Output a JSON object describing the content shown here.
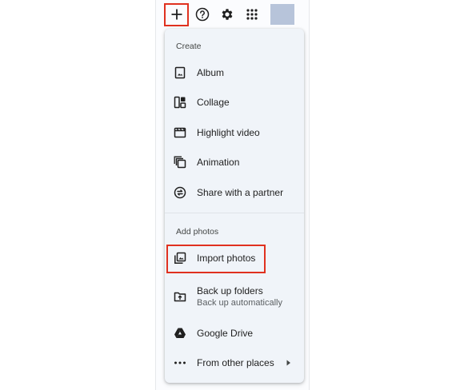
{
  "topbar": {
    "icons": [
      "plus-icon",
      "help-icon",
      "gear-icon",
      "apps-grid-icon"
    ],
    "colors": {
      "highlight": "#e0311f",
      "menu_bg": "#f0f4f9",
      "icon": "#1f1f1f"
    }
  },
  "menu": {
    "create_label": "Create",
    "create_items": [
      {
        "label": "Album",
        "icon": "album-icon"
      },
      {
        "label": "Collage",
        "icon": "collage-icon"
      },
      {
        "label": "Highlight video",
        "icon": "highlight-video-icon"
      },
      {
        "label": "Animation",
        "icon": "animation-icon"
      },
      {
        "label": "Share with a partner",
        "icon": "share-partner-icon"
      }
    ],
    "add_label": "Add photos",
    "add_items": [
      {
        "label": "Import photos",
        "icon": "import-photos-icon"
      },
      {
        "label": "Back up folders",
        "sublabel": "Back up automatically",
        "icon": "backup-folder-icon"
      },
      {
        "label": "Google Drive",
        "icon": "google-drive-icon"
      },
      {
        "label": "From other places",
        "icon": "more-horiz-icon"
      }
    ]
  }
}
